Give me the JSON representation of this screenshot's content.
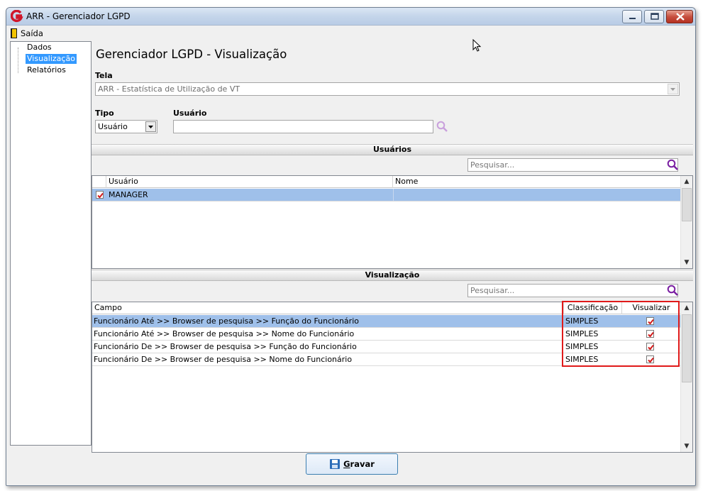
{
  "window": {
    "title": "ARR - Gerenciador LGPD"
  },
  "menu": {
    "exit_label": "Saída"
  },
  "tree": {
    "items": [
      "Dados",
      "Visualização",
      "Relatórios"
    ],
    "selected": "Visualização"
  },
  "page": {
    "title": "Gerenciador LGPD - Visualização"
  },
  "form": {
    "tela_label": "Tela",
    "tela_value": "ARR - Estatística de Utilização de VT",
    "tipo_label": "Tipo",
    "tipo_value": "Usuário",
    "usuario_label": "Usuário",
    "usuario_value": ""
  },
  "usuarios": {
    "section_title": "Usuários",
    "search_placeholder": "Pesquisar...",
    "columns": [
      "Usuário",
      "Nome"
    ],
    "rows": [
      {
        "checked": true,
        "usuario": "MANAGER",
        "nome": ""
      }
    ]
  },
  "visualizacao": {
    "section_title": "Visualização",
    "search_placeholder": "Pesquisar...",
    "columns": [
      "Campo",
      "Classificação",
      "Visualizar"
    ],
    "rows": [
      {
        "campo": "Funcionário Até >> Browser de pesquisa >> Função do Funcionário",
        "classificacao": "SIMPLES",
        "visualizar": true
      },
      {
        "campo": "Funcionário Até >> Browser de pesquisa >> Nome do Funcionário",
        "classificacao": "SIMPLES",
        "visualizar": true
      },
      {
        "campo": "Funcionário De >> Browser de pesquisa >> Função do Funcionário",
        "classificacao": "SIMPLES",
        "visualizar": true
      },
      {
        "campo": "Funcionário De >> Browser de pesquisa >> Nome do Funcionário",
        "classificacao": "SIMPLES",
        "visualizar": true
      }
    ]
  },
  "footer": {
    "save_label_underlined": "G",
    "save_label_rest": "ravar"
  },
  "colors": {
    "selection": "#9fc0ea",
    "highlight": "#e01a1a",
    "check": "#d41a1a",
    "tree_selected": "#3399ff"
  }
}
